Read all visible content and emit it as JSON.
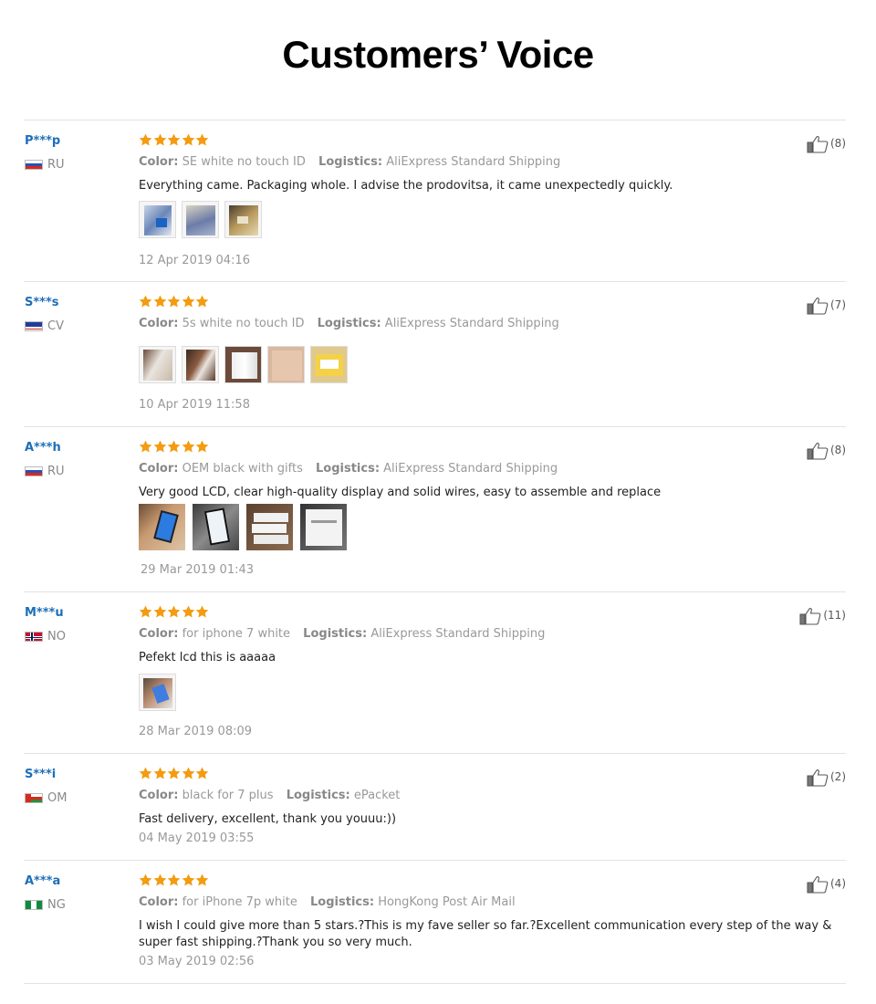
{
  "page": {
    "title": "Customers’ Voice"
  },
  "labels": {
    "color": "Color:",
    "logistics": "Logistics:"
  },
  "reviews": [
    {
      "user": "P***p",
      "country": "RU",
      "flag": "ru",
      "color": "SE white no touch ID",
      "logistics": "AliExpress Standard Shipping",
      "comment": "Everything came. Packaging whole. I advise the prodovitsa, it came unexpectedly quickly.",
      "date": "12 Apr 2019 04:16",
      "likes": "(8)",
      "stars": 5
    },
    {
      "user": "S***s",
      "country": "CV",
      "flag": "cv",
      "color": "5s white no touch ID",
      "logistics": "AliExpress Standard Shipping",
      "comment": "",
      "date": "10 Apr 2019 11:58",
      "likes": "(7)",
      "stars": 5
    },
    {
      "user": "A***h",
      "country": "RU",
      "flag": "ru",
      "color": "OEM black with gifts",
      "logistics": "AliExpress Standard Shipping",
      "comment": "Very good LCD, clear high-quality display and solid wires, easy to assemble and replace",
      "date": "29 Mar 2019 01:43",
      "likes": "(8)",
      "stars": 5
    },
    {
      "user": "M***u",
      "country": "NO",
      "flag": "no",
      "color": "for iphone 7 white",
      "logistics": "AliExpress Standard Shipping",
      "comment": "Pefekt lcd this is aaaaa",
      "date": "28 Mar 2019 08:09",
      "likes": "(11)",
      "stars": 5
    },
    {
      "user": "S***i",
      "country": "OM",
      "flag": "om",
      "color": "black for 7 plus",
      "logistics": "ePacket",
      "comment": "Fast delivery, excellent, thank you youuu:))",
      "date": "04 May 2019 03:55",
      "likes": "(2)",
      "stars": 5
    },
    {
      "user": "A***a",
      "country": "NG",
      "flag": "ng",
      "color": "for iPhone 7p white",
      "logistics": "HongKong Post Air Mail",
      "comment": "I wish I could give more than 5 stars.?This is my fave seller so far.?Excellent communication every step of the way & super fast shipping.?Thank you so very much.",
      "date": "03 May 2019 02:56",
      "likes": "(4)",
      "stars": 5
    }
  ],
  "icons": {
    "rating": "star-icon",
    "like": "thumbs-up-icon"
  },
  "colors": {
    "user": "#1d6fb8",
    "star": "#f39c11",
    "border": "#e3e3e3"
  }
}
